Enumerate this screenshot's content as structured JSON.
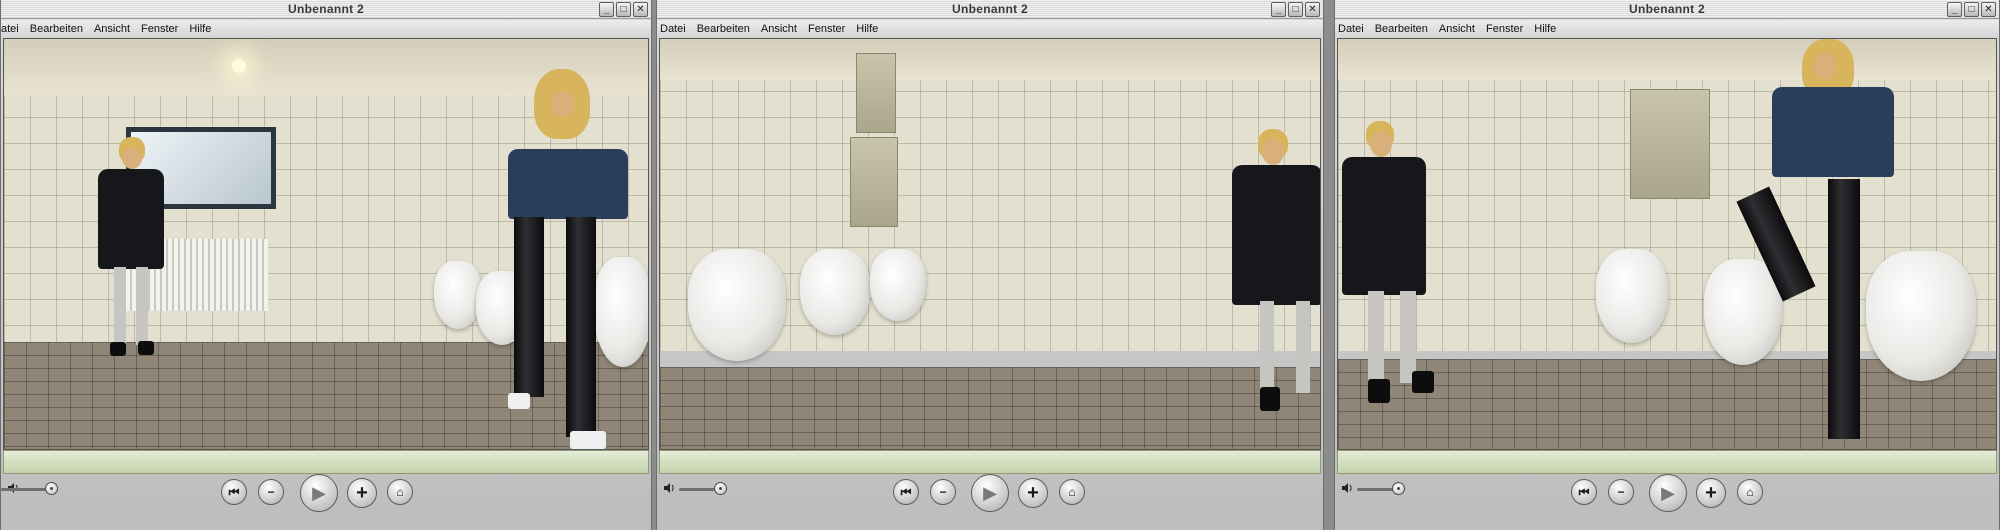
{
  "windows": [
    {
      "title": "Unbenannt 2",
      "menu": [
        "atei",
        "Bearbeiten",
        "Ansicht",
        "Fenster",
        "Hilfe"
      ],
      "window_buttons": [
        "_",
        "□",
        "✕"
      ],
      "controls": {
        "volume_icon": "speaker-icon",
        "volume_level": 1.0
      }
    },
    {
      "title": "Unbenannt 2",
      "menu": [
        "Datei",
        "Bearbeiten",
        "Ansicht",
        "Fenster",
        "Hilfe"
      ],
      "window_buttons": [
        "_",
        "□",
        "✕"
      ],
      "controls": {
        "volume_icon": "speaker-icon",
        "volume_level": 1.0
      }
    },
    {
      "title": "Unbenannt 2",
      "menu": [
        "Datei",
        "Bearbeiten",
        "Ansicht",
        "Fenster",
        "Hilfe"
      ],
      "window_buttons": [
        "_",
        "□",
        "✕"
      ],
      "controls": {
        "volume_icon": "speaker-icon",
        "volume_level": 1.0
      }
    }
  ],
  "player_buttons": {
    "rewind": "⏮",
    "minus": "−",
    "play": "▶",
    "plus": "+",
    "home": "⌂"
  },
  "colors": {
    "window_chrome": "#d0d0d0",
    "status_bar": "#d3dfbf",
    "tile_wall": "#e4e0cf",
    "floor": "#8f8677"
  }
}
